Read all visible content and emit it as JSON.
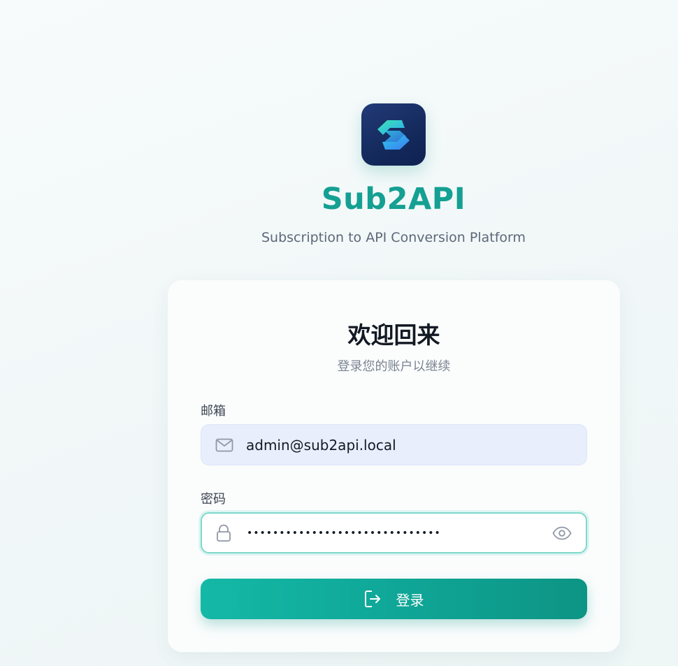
{
  "brand": {
    "name": "Sub2API",
    "tagline": "Subscription to API Conversion Platform",
    "logo_icon": "s-logo-icon",
    "accent": "#14a092"
  },
  "card": {
    "title": "欢迎回来",
    "subtitle": "登录您的账户以继续"
  },
  "form": {
    "email": {
      "label": "邮箱",
      "value": "admin@sub2api.local",
      "icon": "mail-icon"
    },
    "password": {
      "label": "密码",
      "value": "••••••••••••••••••••••••••••••",
      "icon": "lock-icon",
      "toggle_icon": "eye-icon"
    },
    "submit": {
      "label": "登录",
      "icon": "login-icon"
    }
  }
}
